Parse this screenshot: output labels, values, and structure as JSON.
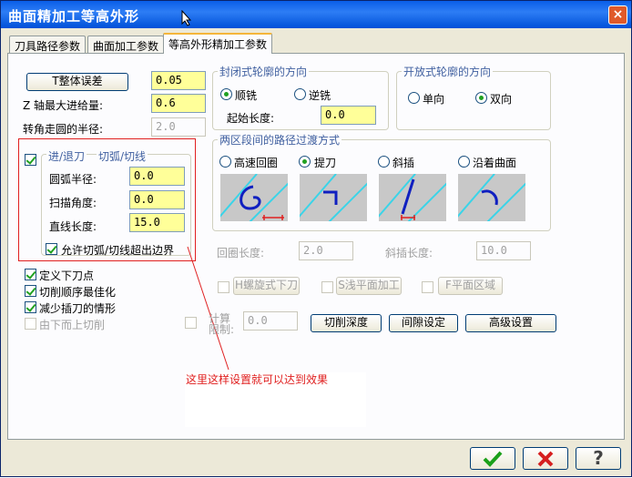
{
  "window": {
    "title": "曲面精加工等高外形",
    "close_label": "×"
  },
  "tabs": [
    {
      "label": "刀具路径参数",
      "active": false
    },
    {
      "label": "曲面加工参数",
      "active": false
    },
    {
      "label": "等高外形精加工参数",
      "active": true
    }
  ],
  "left": {
    "total_error_button": "T整体误差",
    "total_error_value": "0.05",
    "z_step_label": "Z 轴最大进给量:",
    "z_step_value": "0.6",
    "corner_radius_label": "转角走圆的半径:",
    "corner_radius_value": "2.0"
  },
  "entry_exit": {
    "checkbox_label": "进/退刀",
    "title": "切弧/切线",
    "arc_radius_label": "圆弧半径:",
    "arc_radius_value": "0.0",
    "sweep_angle_label": "扫描角度:",
    "sweep_angle_value": "0.0",
    "line_length_label": "直线长度:",
    "line_length_value": "15.0",
    "allow_overflow_label": "允许切弧/切线超出边界"
  },
  "options": {
    "define_plunge": "定义下刀点",
    "optimize_order": "切削顺序最佳化",
    "reduce_plunge": "减少插刀的情形",
    "bottom_up": "由下而上切削"
  },
  "closed_contour": {
    "title": "封闭式轮廓的方向",
    "climb_label": "顺铣",
    "conventional_label": "逆铣",
    "start_length_label": "起始长度:",
    "start_length_value": "0.0"
  },
  "open_contour": {
    "title": "开放式轮廓的方向",
    "one_way_label": "单向",
    "two_way_label": "双向"
  },
  "transition": {
    "title": "两区段间的路径过渡方式",
    "high_speed_label": "高速回圈",
    "lift_label": "提刀",
    "ramp_label": "斜插",
    "follow_surface_label": "沿着曲面",
    "loop_length_label": "回圈长度:",
    "loop_length_value": "2.0",
    "ramp_length_label": "斜插长度:",
    "ramp_length_value": "10.0"
  },
  "bottom_row": {
    "helix_button": "H螺旋式下刀",
    "shallow_button": "S浅平面加工",
    "flat_button": "F平面区域",
    "calc_label_1": "计算",
    "calc_label_2": "限制:",
    "calc_value": "0.0",
    "cut_depth_button": "切削深度",
    "gap_button": "间隙设定",
    "advanced_button": "高级设置"
  },
  "annotation": {
    "text": "这里这样设置就可以达到效果"
  },
  "footer": {
    "ok_icon": "check-icon",
    "cancel_icon": "x-icon",
    "help_icon": "question-icon",
    "help_glyph": "?"
  },
  "colors": {
    "accent_red": "#e02020",
    "input_yellow": "#ffff99",
    "preview_cyan": "#3ad4e8",
    "preview_blue": "#1020c0"
  }
}
